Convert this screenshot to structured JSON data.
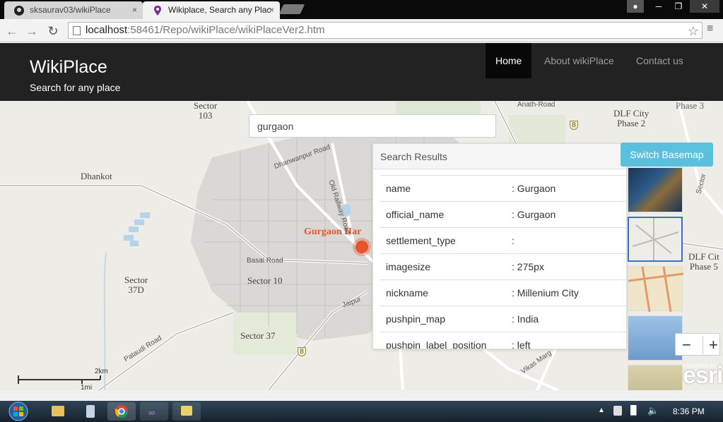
{
  "browser": {
    "tabs": [
      {
        "label": "sksaurav03/wikiPlace",
        "close": "×"
      },
      {
        "label": "Wikiplace, Search any Plac",
        "close": "×"
      }
    ],
    "url_host": "localhost",
    "url_path": ":58461/Repo/wikiPlace/wikiPlaceVer2.htm",
    "back": "←",
    "forward": "→",
    "reload": "↻",
    "star": "☆",
    "menu": "≡"
  },
  "header": {
    "brand": "WikiPlace",
    "tagline": "Search for any place",
    "nav": [
      "Home",
      "About wikiPlace",
      "Contact us"
    ]
  },
  "map": {
    "search_value": "gurgaon",
    "labels": {
      "sector103": "Sector\n103",
      "dhankot": "Dhankot",
      "sector37d": "Sector\n37D",
      "sector10": "Sector 10",
      "sector37": "Sector 37",
      "dlf2": "DLF City\nPhase 2",
      "dlf5": "DLF Cit\nPhase 5",
      "gurgaon_har": "Gurgaon Har",
      "basai_road": "Basai Road",
      "pataudi_road": "Pataudi Road",
      "anath_road": "Anath-Road",
      "old_railway": "Old Railway Road",
      "dhanwanpur": "Dhanwanpur Road",
      "jaipur": "Jaipur",
      "vikas_marg": "Vikas Marg",
      "sector_right": "Sector",
      "phase3": "Phase 3",
      "shield8": "8"
    },
    "scale_km": "2km",
    "scale_mi": "1mi",
    "switch_basemap": "Switch Basemap",
    "zoom_out": "−",
    "zoom_in": "+",
    "esri": "esri",
    "powered_by": "POWERED BY"
  },
  "results": {
    "title": "Search Results",
    "rows": [
      {
        "key": "name",
        "value": ": Gurgaon"
      },
      {
        "key": "official_name",
        "value": ": Gurgaon"
      },
      {
        "key": "settlement_type",
        "value": ":"
      },
      {
        "key": "imagesize",
        "value": ": 275px"
      },
      {
        "key": "nickname",
        "value": ": Millenium City"
      },
      {
        "key": "pushpin_map",
        "value": ": India"
      },
      {
        "key": "pushpin_label_position",
        "value": ": left"
      }
    ]
  },
  "taskbar": {
    "time": "8:36 PM"
  },
  "colors": {
    "header_bg": "#222222",
    "switch_btn": "#5bc0de",
    "marker": "#e8542c"
  }
}
